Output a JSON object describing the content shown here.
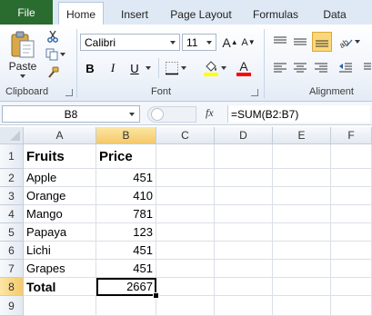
{
  "ribbon_tabs": {
    "file": "File",
    "home": "Home",
    "insert": "Insert",
    "page_layout": "Page Layout",
    "formulas": "Formulas",
    "data": "Data"
  },
  "clipboard": {
    "paste_label": "Paste",
    "group_label": "Clipboard"
  },
  "font": {
    "family": "Calibri",
    "size": "11",
    "grow_label": "A",
    "shrink_label": "A",
    "bold": "B",
    "italic": "I",
    "underline": "U",
    "font_color_label": "A",
    "group_label": "Font"
  },
  "alignment": {
    "group_label": "Alignment"
  },
  "formula_bar": {
    "name_box": "B8",
    "fx": "fx",
    "formula": "=SUM(B2:B7)"
  },
  "sheet": {
    "columns": [
      "A",
      "B",
      "C",
      "D",
      "E",
      "F"
    ],
    "rows": [
      "1",
      "2",
      "3",
      "4",
      "5",
      "6",
      "7",
      "8",
      "9"
    ],
    "cells": {
      "A1": "Fruits",
      "B1": "Price",
      "A2": "Apple",
      "B2": "451",
      "A3": "Orange",
      "B3": "410",
      "A4": "Mango",
      "B4": "781",
      "A5": "Papaya",
      "B5": "123",
      "A6": "Lichi",
      "B6": "451",
      "A7": "Grapes",
      "B7": "451",
      "A8": "Total",
      "B8": "2667"
    },
    "selected_cell": "B8"
  },
  "colors": {
    "file_tab": "#2a6b2f",
    "header_selected": "#f5c96a",
    "fill_color_bar": "#ffff00",
    "font_color_bar": "#ff0000"
  }
}
